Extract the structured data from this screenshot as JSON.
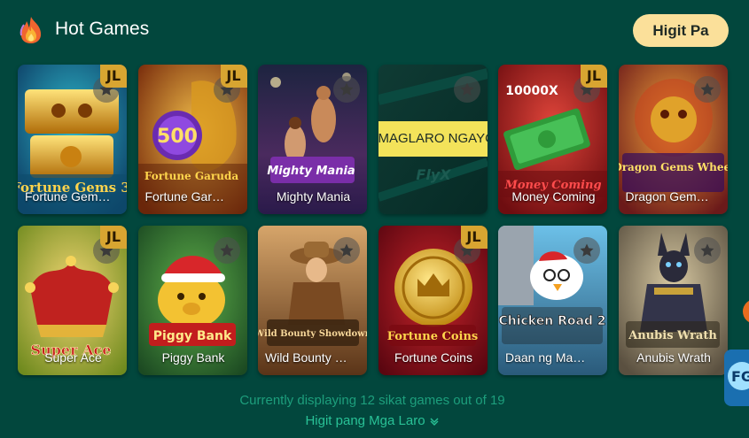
{
  "header": {
    "title": "Hot Games",
    "more_label": "Higit Pa",
    "icon": "fire-icon"
  },
  "colors": {
    "background": "#02473d",
    "more_button": "#fbe09a",
    "count_text": "#1d9e7c",
    "link_text": "#29c196",
    "jl_badge": "#d8a531"
  },
  "games": [
    {
      "name": "Fortune Gem…",
      "logo": "Fortune Gems 3",
      "jl": "JL"
    },
    {
      "name": "Fortune Gar…",
      "logo": "Fortune Garuda",
      "jl": "JL",
      "art_text": "500"
    },
    {
      "name": "Mighty Mania",
      "logo": "Mighty Mania"
    },
    {
      "name": "",
      "play_label": "MAGLARO NGAYON"
    },
    {
      "name": "Money Coming",
      "logo": "Money Coming",
      "jl": "JL",
      "art_text": "10000X"
    },
    {
      "name": "Dragon Gem…",
      "logo": "Dragon Gems Wheel"
    },
    {
      "name": "Super Ace",
      "logo": "Super Ace",
      "jl": "JL"
    },
    {
      "name": "Piggy Bank",
      "logo": "Piggy Bank"
    },
    {
      "name": "Wild Bounty …",
      "logo": "Wild Bounty Showdown"
    },
    {
      "name": "Fortune Coins",
      "logo": "Fortune Coins",
      "jl": "JL"
    },
    {
      "name": "Daan ng Ma…",
      "logo": "Chicken Road 2"
    },
    {
      "name": "Anubis Wrath",
      "logo": "Anubis Wrath"
    }
  ],
  "footer": {
    "count_text": "Currently displaying 12 sikat games out of 19",
    "more_games_label": "Higit pang Mga Laro"
  }
}
